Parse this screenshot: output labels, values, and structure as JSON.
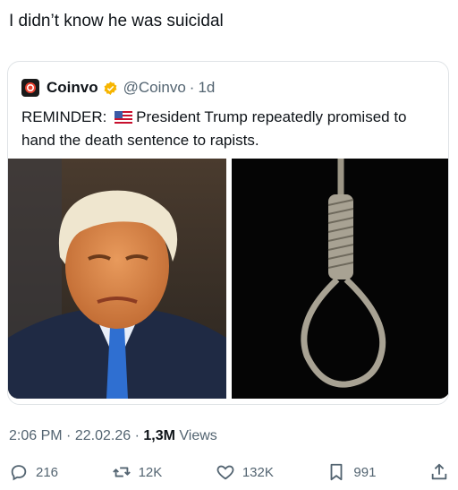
{
  "post": {
    "text": "I didn’t know he was suicidal"
  },
  "quote": {
    "name": "Coinvo",
    "handle": "@Coinvo",
    "separator": "·",
    "age": "1d",
    "text_prefix": "REMINDER:",
    "text_body": "President Trump repeatedly promised to hand the death sentence to rapists.",
    "icons": {
      "avatar": "coinvo-logo-icon",
      "verified": "verified-badge-icon",
      "flag": "us-flag-icon"
    },
    "images": [
      "portrait-photo",
      "noose-photo"
    ]
  },
  "meta": {
    "time": "2:06 PM",
    "date": "22.02.26",
    "views_count": "1,3M",
    "views_label": "Views",
    "separator": "·"
  },
  "actions": {
    "replies": "216",
    "reposts": "12K",
    "likes": "132K",
    "bookmarks": "991"
  },
  "colors": {
    "text": "#0f1419",
    "muted": "#536471",
    "verified": "#f7b500",
    "border": "#dfe3e6"
  }
}
